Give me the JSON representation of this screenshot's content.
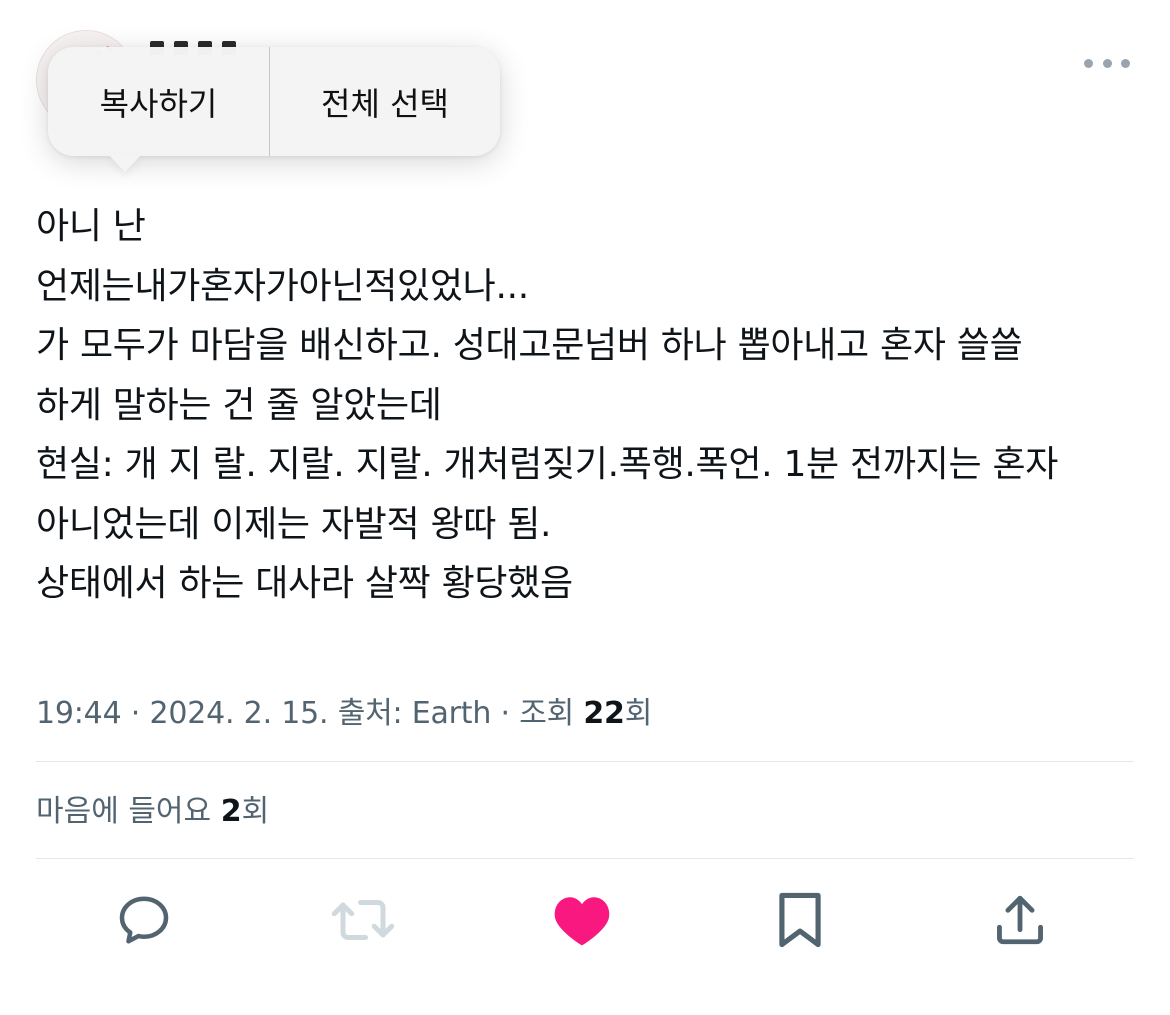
{
  "edit_menu": {
    "copy_label": "복사하기",
    "select_all_label": "전체 선택"
  },
  "tweet": {
    "lines": [
      "아니 난",
      "언제는내가혼자가아닌적있었나...",
      "가 모두가 마담을 배신하고. 성대고문넘버 하나 뽑아내고 혼자 쓸쓸",
      "하게 말하는 건 줄 알았는데",
      "현실: 개 지 랄. 지랄. 지랄. 개처럼짖기.폭행.폭언. 1분 전까지는 혼자",
      "아니었는데 이제는 자발적 왕따 됨.",
      "상태에서 하는 대사라 살짝 황당했음"
    ],
    "meta_prefix": "19:44 · 2024. 2. 15. 출처: Earth · 조회 ",
    "view_count": "22",
    "view_suffix": "회",
    "likes_prefix": "마음에 들어요 ",
    "like_count": "2",
    "likes_suffix": "회"
  },
  "icons": {
    "more": "more-horizontal-icon",
    "reply": "reply-bubble-icon",
    "retweet": "retweet-icon",
    "like": "heart-filled-icon",
    "bookmark": "bookmark-icon",
    "share": "share-upload-icon"
  },
  "colors": {
    "text_primary": "#0f1419",
    "text_secondary": "#536471",
    "like_active": "#f91880",
    "icon_gray": "#536471",
    "icon_disabled": "#cfd9de",
    "divider": "#e3e7ea"
  }
}
